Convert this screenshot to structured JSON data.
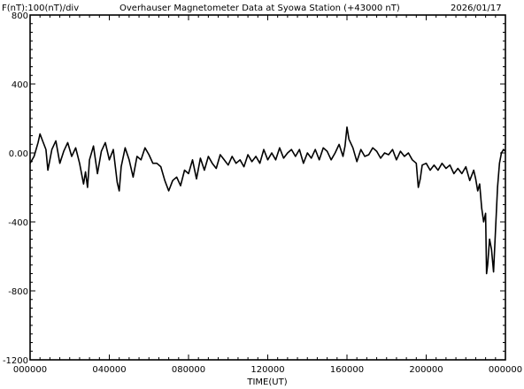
{
  "chart_data": {
    "type": "line",
    "header_left": "F(nT):100(nT)/div",
    "title": "Overhauser Magnetometer Data at Syowa Station (+43000 nT)",
    "date": "2026/01/17",
    "xlabel": "TIME(UT)",
    "ylabel": "",
    "x_unit": "hours UT",
    "xlim": [
      0,
      24
    ],
    "ylim": [
      -1200,
      800
    ],
    "y_ticks": [
      800,
      400,
      0,
      -400,
      -800,
      -1200
    ],
    "y_tick_labels": [
      "800",
      "400",
      "0.00",
      "-400",
      "-800",
      "-1200"
    ],
    "x_ticks": [
      0,
      4,
      8,
      12,
      16,
      20,
      24
    ],
    "x_tick_labels": [
      "000000",
      "040000",
      "080000",
      "120000",
      "160000",
      "200000",
      "000000"
    ],
    "grid": false,
    "line_color": "#000000",
    "series": [
      {
        "name": "",
        "x": [
          0.0,
          0.2,
          0.4,
          0.5,
          0.6,
          0.8,
          0.9,
          1.1,
          1.3,
          1.5,
          1.7,
          1.9,
          2.1,
          2.3,
          2.5,
          2.7,
          2.8,
          2.9,
          3.0,
          3.2,
          3.4,
          3.6,
          3.8,
          4.0,
          4.2,
          4.4,
          4.5,
          4.6,
          4.8,
          5.0,
          5.2,
          5.4,
          5.6,
          5.8,
          6.0,
          6.2,
          6.4,
          6.6,
          6.8,
          7.0,
          7.2,
          7.4,
          7.6,
          7.8,
          8.0,
          8.2,
          8.4,
          8.6,
          8.8,
          9.0,
          9.2,
          9.4,
          9.6,
          9.8,
          10.0,
          10.2,
          10.4,
          10.6,
          10.8,
          11.0,
          11.2,
          11.4,
          11.6,
          11.8,
          12.0,
          12.2,
          12.4,
          12.6,
          12.8,
          13.0,
          13.2,
          13.4,
          13.6,
          13.8,
          14.0,
          14.2,
          14.4,
          14.6,
          14.8,
          15.0,
          15.2,
          15.4,
          15.6,
          15.8,
          15.9,
          16.0,
          16.1,
          16.3,
          16.5,
          16.7,
          16.9,
          17.1,
          17.3,
          17.5,
          17.7,
          17.9,
          18.1,
          18.3,
          18.5,
          18.7,
          18.9,
          19.1,
          19.3,
          19.5,
          19.6,
          19.7,
          19.8,
          20.0,
          20.2,
          20.4,
          20.6,
          20.8,
          21.0,
          21.2,
          21.4,
          21.6,
          21.8,
          22.0,
          22.2,
          22.4,
          22.5,
          22.6,
          22.7,
          22.8,
          22.9,
          23.0,
          23.05,
          23.1,
          23.2,
          23.3,
          23.4,
          23.5,
          23.6,
          23.7,
          23.8,
          23.9,
          24.0
        ],
        "y": [
          -60,
          -20,
          60,
          110,
          80,
          20,
          -100,
          20,
          70,
          -60,
          10,
          60,
          -20,
          30,
          -60,
          -180,
          -110,
          -200,
          -40,
          40,
          -120,
          10,
          60,
          -40,
          20,
          -170,
          -220,
          -80,
          30,
          -40,
          -140,
          -20,
          -40,
          30,
          -10,
          -60,
          -60,
          -80,
          -160,
          -220,
          -160,
          -140,
          -190,
          -100,
          -120,
          -40,
          -150,
          -30,
          -100,
          -20,
          -60,
          -90,
          -10,
          -40,
          -70,
          -20,
          -60,
          -40,
          -80,
          -10,
          -50,
          -20,
          -60,
          20,
          -40,
          0,
          -40,
          30,
          -30,
          0,
          20,
          -20,
          20,
          -60,
          0,
          -30,
          20,
          -40,
          30,
          10,
          -40,
          0,
          50,
          -20,
          40,
          150,
          80,
          30,
          -50,
          20,
          -20,
          -10,
          30,
          10,
          -30,
          0,
          -10,
          20,
          -40,
          10,
          -20,
          0,
          -40,
          -60,
          -200,
          -150,
          -70,
          -60,
          -100,
          -70,
          -100,
          -60,
          -90,
          -70,
          -120,
          -90,
          -120,
          -80,
          -160,
          -100,
          -150,
          -220,
          -180,
          -320,
          -400,
          -350,
          -700,
          -650,
          -500,
          -560,
          -690,
          -450,
          -200,
          -60,
          0,
          20,
          10
        ]
      }
    ]
  }
}
